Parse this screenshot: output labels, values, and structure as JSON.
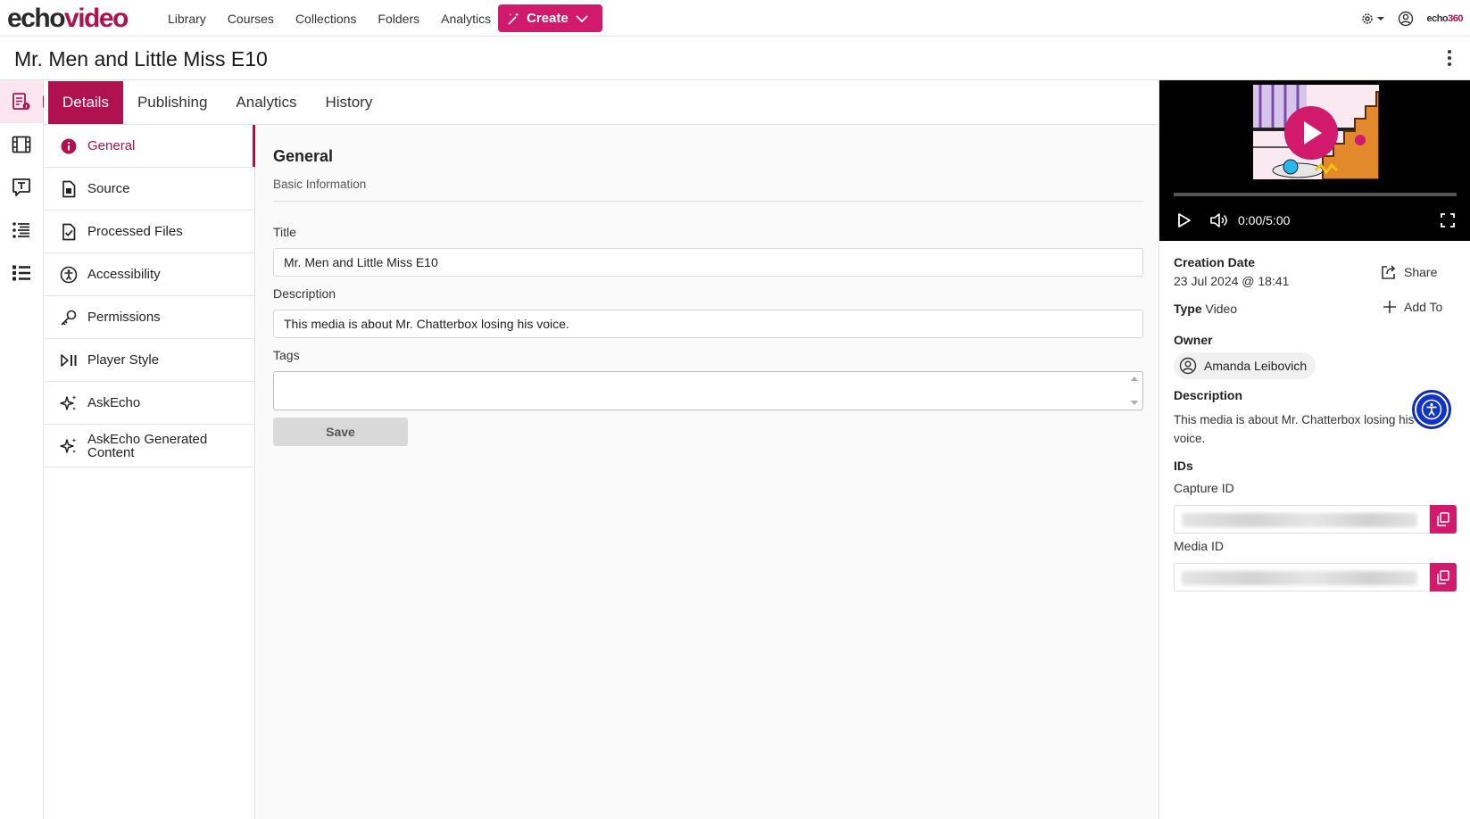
{
  "brand": {
    "part1": "echo",
    "part2": "video",
    "small_a": "echo",
    "small_b": "360"
  },
  "nav": {
    "links": [
      "Library",
      "Courses",
      "Collections",
      "Folders",
      "Analytics"
    ],
    "create_label": "Create"
  },
  "page": {
    "title": "Mr. Men and Little Miss E10"
  },
  "tabs": [
    "Details",
    "Publishing",
    "Analytics",
    "History"
  ],
  "sections": [
    {
      "label": "General",
      "icon": "info-icon"
    },
    {
      "label": "Source",
      "icon": "file-icon"
    },
    {
      "label": "Processed Files",
      "icon": "file-check-icon"
    },
    {
      "label": "Accessibility",
      "icon": "accessibility-icon"
    },
    {
      "label": "Permissions",
      "icon": "key-icon"
    },
    {
      "label": "Player Style",
      "icon": "play-pause-icon"
    },
    {
      "label": "AskEcho",
      "icon": "sparkle-icon"
    },
    {
      "label": "AskEcho Generated Content",
      "icon": "sparkle-icon"
    }
  ],
  "form": {
    "heading": "General",
    "subheading": "Basic Information",
    "title_label": "Title",
    "title_value": "Mr. Men and Little Miss E10",
    "description_label": "Description",
    "description_value": "This media is about Mr. Chatterbox losing his voice.",
    "tags_label": "Tags",
    "save_label": "Save"
  },
  "player": {
    "time": "0:00/5:00",
    "progress": 0
  },
  "meta": {
    "creation_label": "Creation Date",
    "creation_value": "23 Jul 2024 @ 18:41",
    "type_label": "Type",
    "type_value": "Video",
    "share_label": "Share",
    "add_to_label": "Add To",
    "owner_label": "Owner",
    "owner_value": "Amanda Leibovich",
    "description_label": "Description",
    "description_value": "This media is about Mr. Chatterbox losing his voice.",
    "ids_label": "IDs",
    "capture_id_label": "Capture ID",
    "media_id_label": "Media ID"
  },
  "colors": {
    "accent": "#b0124f",
    "create": "#d11a6b",
    "a11y": "#1034c7"
  }
}
